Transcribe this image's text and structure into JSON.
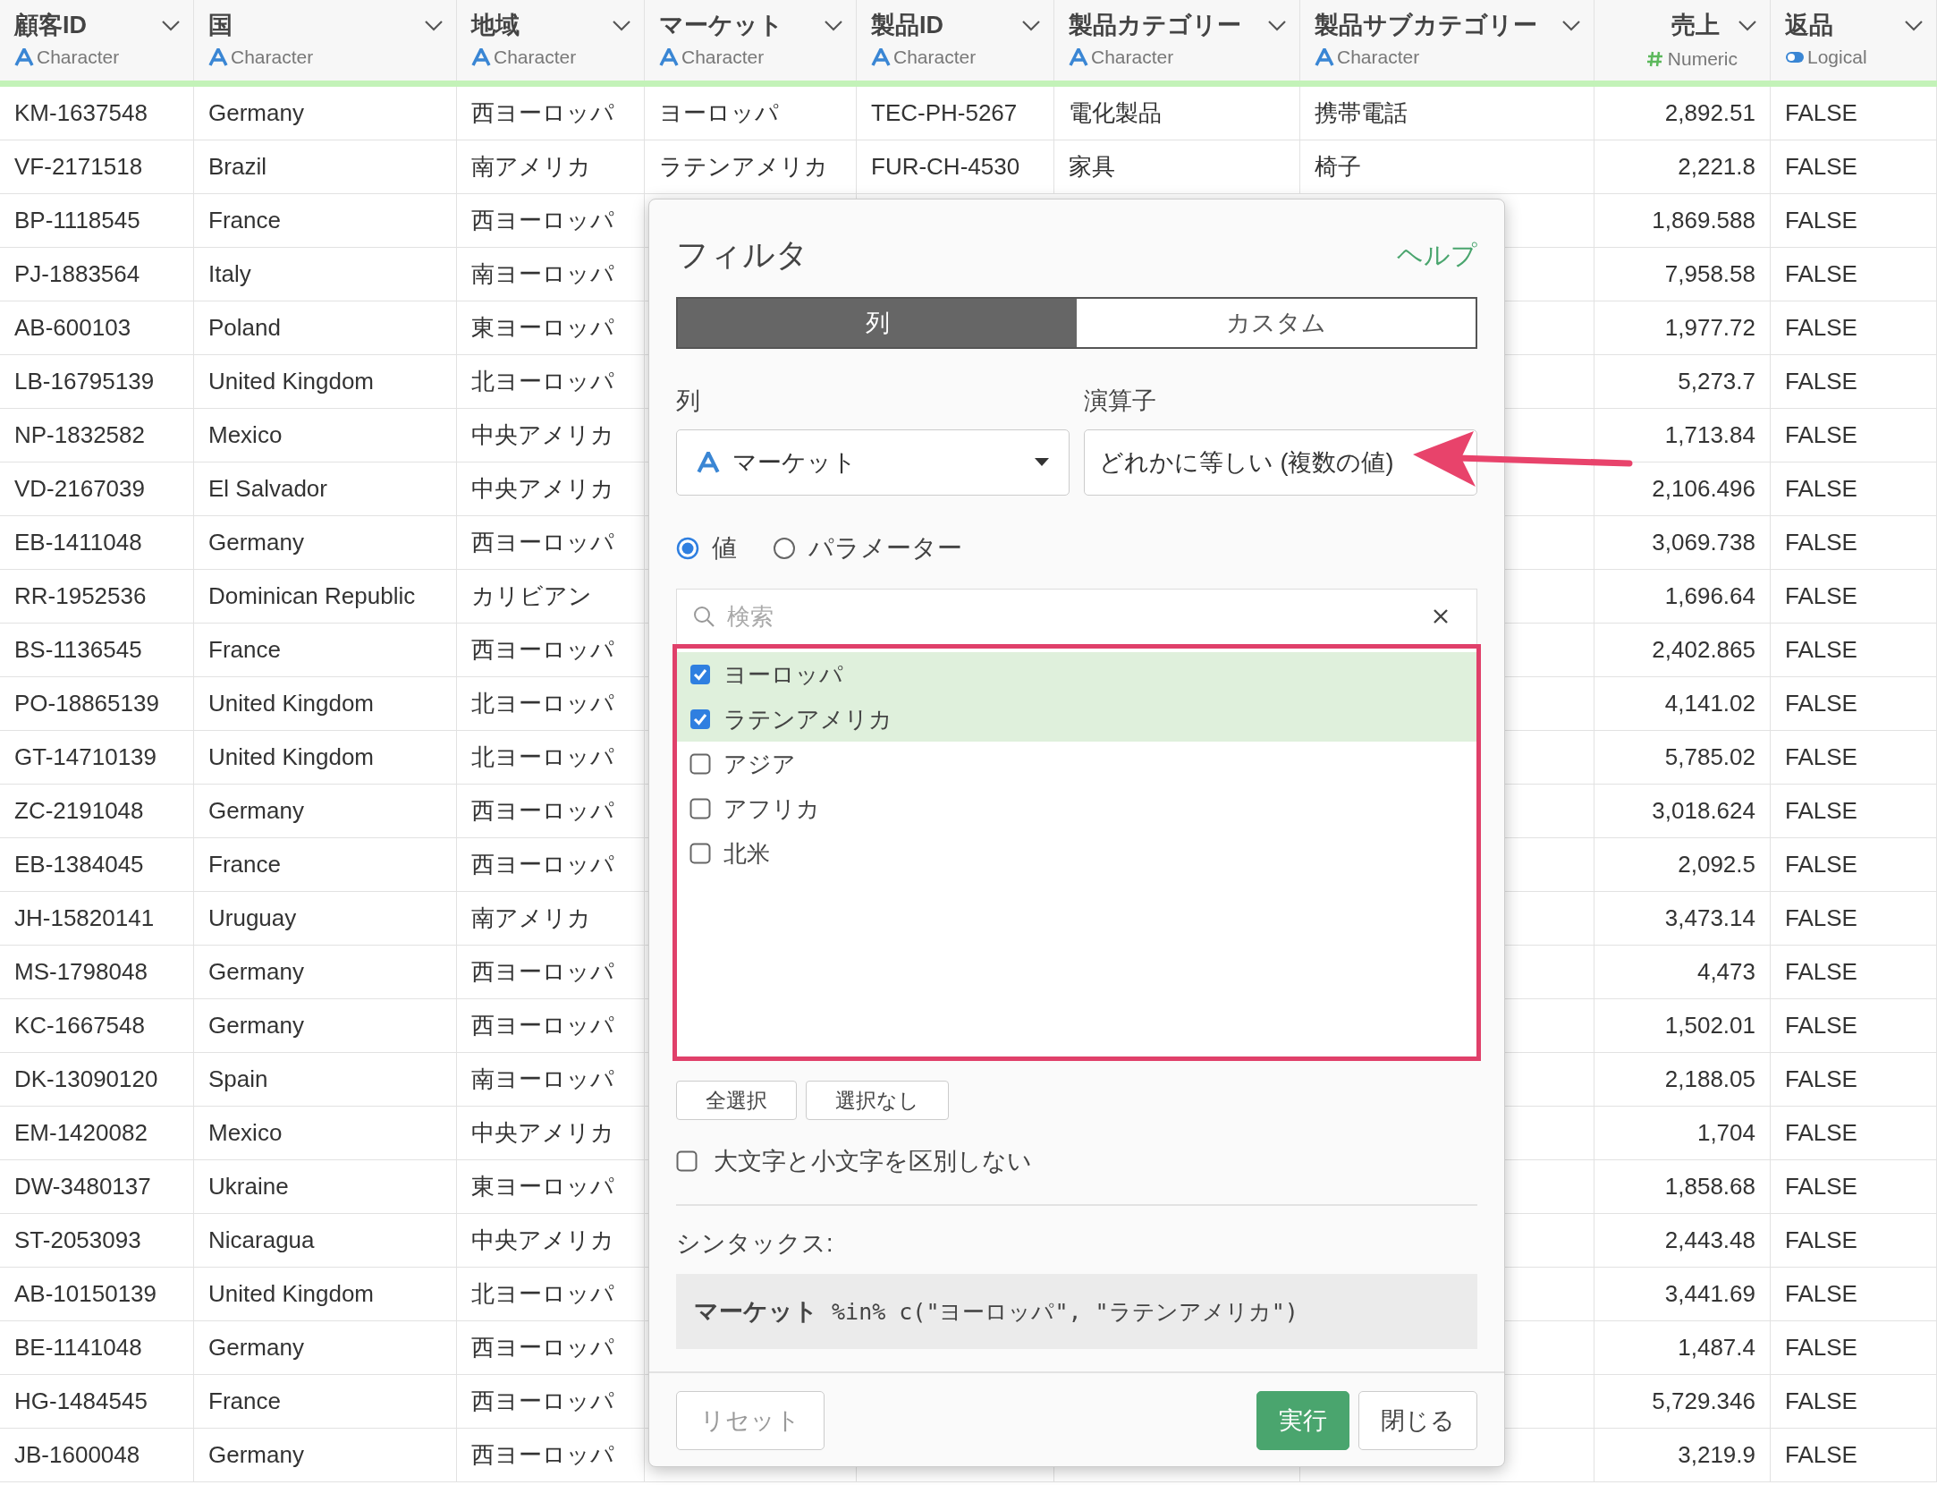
{
  "table": {
    "columns": [
      {
        "name": "顧客ID",
        "type": "Character"
      },
      {
        "name": "国",
        "type": "Character"
      },
      {
        "name": "地域",
        "type": "Character"
      },
      {
        "name": "マーケット",
        "type": "Character"
      },
      {
        "name": "製品ID",
        "type": "Character"
      },
      {
        "name": "製品カテゴリー",
        "type": "Character"
      },
      {
        "name": "製品サブカテゴリー",
        "type": "Character"
      },
      {
        "name": "売上",
        "type": "Numeric"
      },
      {
        "name": "返品",
        "type": "Logical"
      }
    ],
    "rows": [
      {
        "customer_id": "KM-1637548",
        "country": "Germany",
        "region": "西ヨーロッパ",
        "market": "ヨーロッパ",
        "product_id": "TEC-PH-5267",
        "category": "電化製品",
        "subcategory": "携帯電話",
        "sales": "2,892.51",
        "returned": "FALSE"
      },
      {
        "customer_id": "VF-2171518",
        "country": "Brazil",
        "region": "南アメリカ",
        "market": "ラテンアメリカ",
        "product_id": "FUR-CH-4530",
        "category": "家具",
        "subcategory": "椅子",
        "sales": "2,221.8",
        "returned": "FALSE"
      },
      {
        "customer_id": "BP-1118545",
        "country": "France",
        "region": "西ヨーロッパ",
        "sales": "1,869.588",
        "returned": "FALSE"
      },
      {
        "customer_id": "PJ-1883564",
        "country": "Italy",
        "region": "南ヨーロッパ",
        "sales": "7,958.58",
        "returned": "FALSE"
      },
      {
        "customer_id": "AB-600103",
        "country": "Poland",
        "region": "東ヨーロッパ",
        "sales": "1,977.72",
        "returned": "FALSE"
      },
      {
        "customer_id": "LB-16795139",
        "country": "United Kingdom",
        "region": "北ヨーロッパ",
        "sales": "5,273.7",
        "returned": "FALSE"
      },
      {
        "customer_id": "NP-1832582",
        "country": "Mexico",
        "region": "中央アメリカ",
        "sales": "1,713.84",
        "returned": "FALSE"
      },
      {
        "customer_id": "VD-2167039",
        "country": "El Salvador",
        "region": "中央アメリカ",
        "sales": "2,106.496",
        "returned": "FALSE"
      },
      {
        "customer_id": "EB-1411048",
        "country": "Germany",
        "region": "西ヨーロッパ",
        "sales": "3,069.738",
        "returned": "FALSE"
      },
      {
        "customer_id": "RR-1952536",
        "country": "Dominican Republic",
        "region": "カリビアン",
        "sales": "1,696.64",
        "returned": "FALSE"
      },
      {
        "customer_id": "BS-1136545",
        "country": "France",
        "region": "西ヨーロッパ",
        "sales": "2,402.865",
        "returned": "FALSE"
      },
      {
        "customer_id": "PO-18865139",
        "country": "United Kingdom",
        "region": "北ヨーロッパ",
        "sales": "4,141.02",
        "returned": "FALSE"
      },
      {
        "customer_id": "GT-14710139",
        "country": "United Kingdom",
        "region": "北ヨーロッパ",
        "sales": "5,785.02",
        "returned": "FALSE"
      },
      {
        "customer_id": "ZC-2191048",
        "country": "Germany",
        "region": "西ヨーロッパ",
        "sales": "3,018.624",
        "returned": "FALSE"
      },
      {
        "customer_id": "EB-1384045",
        "country": "France",
        "region": "西ヨーロッパ",
        "sales": "2,092.5",
        "returned": "FALSE"
      },
      {
        "customer_id": "JH-15820141",
        "country": "Uruguay",
        "region": "南アメリカ",
        "sales": "3,473.14",
        "returned": "FALSE"
      },
      {
        "customer_id": "MS-1798048",
        "country": "Germany",
        "region": "西ヨーロッパ",
        "sales": "4,473",
        "returned": "FALSE"
      },
      {
        "customer_id": "KC-1667548",
        "country": "Germany",
        "region": "西ヨーロッパ",
        "sales": "1,502.01",
        "returned": "FALSE"
      },
      {
        "customer_id": "DK-13090120",
        "country": "Spain",
        "region": "南ヨーロッパ",
        "sales": "2,188.05",
        "returned": "FALSE"
      },
      {
        "customer_id": "EM-1420082",
        "country": "Mexico",
        "region": "中央アメリカ",
        "sales": "1,704",
        "returned": "FALSE"
      },
      {
        "customer_id": "DW-3480137",
        "country": "Ukraine",
        "region": "東ヨーロッパ",
        "sales": "1,858.68",
        "returned": "FALSE"
      },
      {
        "customer_id": "ST-2053093",
        "country": "Nicaragua",
        "region": "中央アメリカ",
        "sales": "2,443.48",
        "returned": "FALSE"
      },
      {
        "customer_id": "AB-10150139",
        "country": "United Kingdom",
        "region": "北ヨーロッパ",
        "sales": "3,441.69",
        "returned": "FALSE"
      },
      {
        "customer_id": "BE-1141048",
        "country": "Germany",
        "region": "西ヨーロッパ",
        "sales": "1,487.4",
        "returned": "FALSE"
      },
      {
        "customer_id": "HG-1484545",
        "country": "France",
        "region": "西ヨーロッパ",
        "sales": "5,729.346",
        "returned": "FALSE"
      },
      {
        "customer_id": "JB-1600048",
        "country": "Germany",
        "region": "西ヨーロッパ",
        "sales": "3,219.9",
        "returned": "FALSE"
      }
    ]
  },
  "filter_dialog": {
    "title": "フィルタ",
    "help_link": "ヘルプ",
    "tabs": [
      {
        "label": "列",
        "selected": true
      },
      {
        "label": "カスタム",
        "selected": false
      }
    ],
    "column_label": "列",
    "operator_label": "演算子",
    "column_select": {
      "value": "マーケット"
    },
    "operator_select": {
      "value": "どれかに等しい (複数の値)"
    },
    "source_options": [
      {
        "label": "値",
        "selected": true
      },
      {
        "label": "パラメーター",
        "selected": false
      }
    ],
    "search": {
      "placeholder": "検索"
    },
    "values": [
      {
        "label": "ヨーロッパ",
        "checked": true
      },
      {
        "label": "ラテンアメリカ",
        "checked": true
      },
      {
        "label": "アジア",
        "checked": false
      },
      {
        "label": "アフリカ",
        "checked": false
      },
      {
        "label": "北米",
        "checked": false
      }
    ],
    "select_all_button": "全選択",
    "select_none_button": "選択なし",
    "ignore_case": {
      "label": "大文字と小文字を区別しない",
      "checked": false
    },
    "syntax_label": "シンタックス:",
    "syntax": "**マーケット** %in% c(\"ヨーロッパ\", \"ラテンアメリカ\")",
    "footer_buttons": [
      {
        "label": "リセット",
        "kind": "secondary",
        "disabled": true
      },
      {
        "label": "実行",
        "kind": "primary",
        "disabled": false
      },
      {
        "label": "閉じる",
        "kind": "secondary",
        "disabled": false
      }
    ]
  }
}
